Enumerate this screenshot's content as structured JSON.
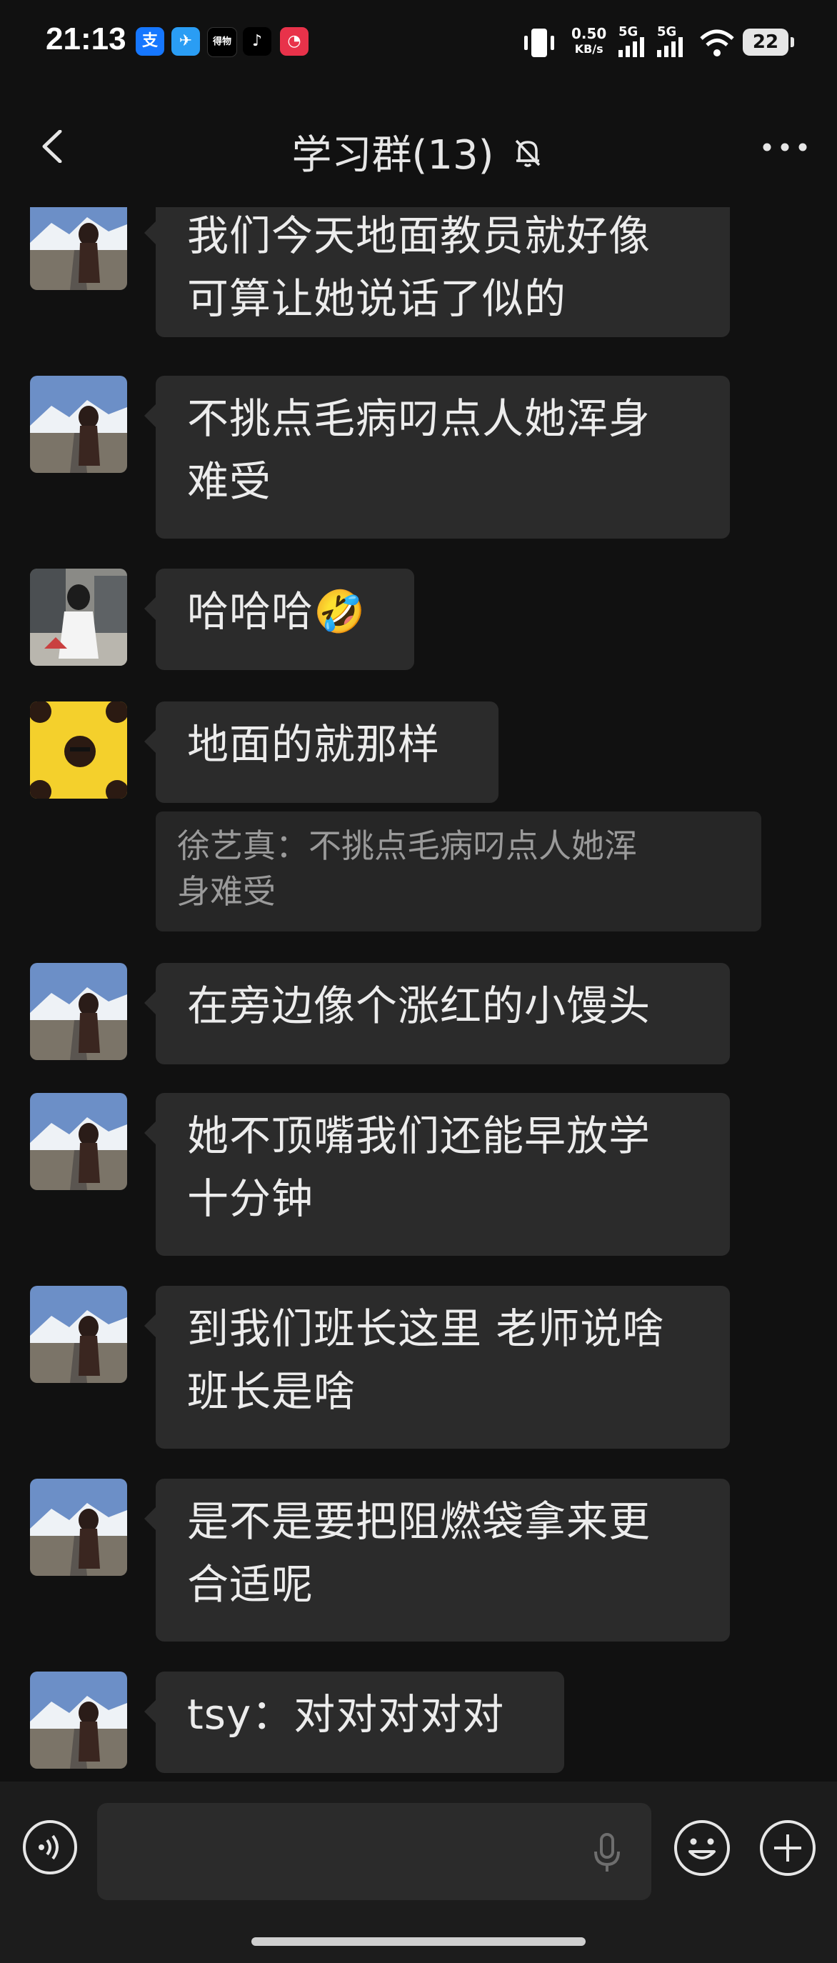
{
  "status_bar": {
    "time": "21:13",
    "apps": [
      {
        "icon": "alipay-icon",
        "glyph": "支",
        "color": "#1677ff"
      },
      {
        "icon": "bird-app-icon",
        "glyph": "✈",
        "color": "#2a9df4"
      },
      {
        "icon": "app-icon-black",
        "glyph": "得物",
        "color": "#000000"
      },
      {
        "icon": "tiktok-icon",
        "glyph": "♪",
        "color": "#000000"
      },
      {
        "icon": "app-icon-red",
        "glyph": "◔",
        "color": "#e8324a"
      }
    ],
    "speed_value": "0.50",
    "speed_unit": "KB/s",
    "net1": "5G",
    "net2": "5G",
    "battery": "22"
  },
  "header": {
    "title": "学习群(13)",
    "back_icon": "chevron-left-icon",
    "mute_icon": "bell-off-icon",
    "more_icon": "more-dots-icon"
  },
  "messages": [
    {
      "avatar": "avatar-mountain",
      "text_lines": [
        "我们今天地面教员就好像",
        "可算让她说话了似的"
      ]
    },
    {
      "avatar": "avatar-mountain",
      "text_lines": [
        "不挑点毛病叼点人她浑身",
        "难受"
      ]
    },
    {
      "avatar": "avatar-street",
      "text_lines": [
        "哈哈哈🤣"
      ]
    },
    {
      "avatar": "avatar-yellow",
      "text_lines": [
        "地面的就那样"
      ],
      "quote_lines": [
        "徐艺真：不挑点毛病叼点人她浑",
        "身难受"
      ]
    },
    {
      "avatar": "avatar-mountain",
      "text_lines": [
        "在旁边像个涨红的小馒头"
      ]
    },
    {
      "avatar": "avatar-mountain",
      "text_lines": [
        "她不顶嘴我们还能早放学",
        "十分钟"
      ]
    },
    {
      "avatar": "avatar-mountain",
      "text_lines": [
        "到我们班长这里 老师说啥",
        "班长是啥"
      ]
    },
    {
      "avatar": "avatar-mountain",
      "text_lines": [
        "是不是要把阻燃袋拿来更",
        "合适呢"
      ]
    },
    {
      "avatar": "avatar-mountain",
      "text_lines": [
        "tsy：对对对对对"
      ]
    }
  ],
  "input_bar": {
    "voice_icon": "voice-input-icon",
    "mic_icon": "microphone-icon",
    "emoji_icon": "emoji-icon",
    "plus_icon": "plus-icon"
  }
}
